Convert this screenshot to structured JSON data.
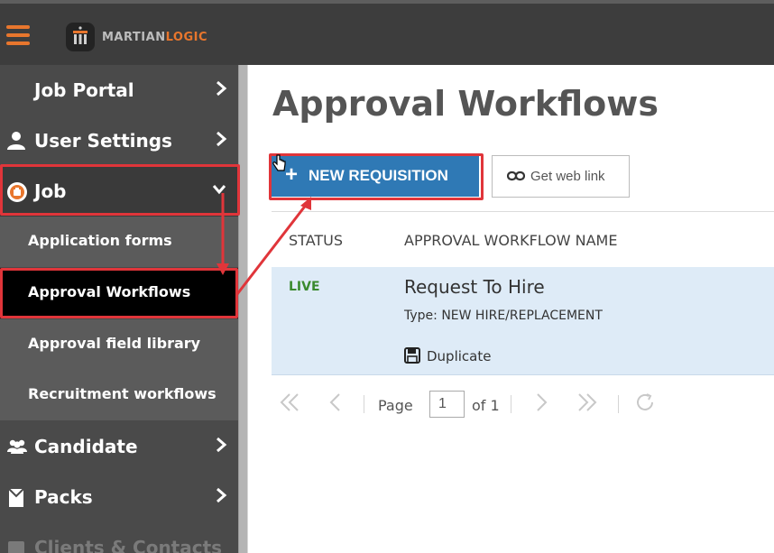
{
  "app": {
    "brand_part1": "MARTIAN",
    "brand_part2": "LOGIC",
    "accent_color": "#e8762d",
    "menu_icon": "hamburger-icon"
  },
  "sidebar": {
    "items": [
      {
        "label": "Job Portal",
        "icon": "",
        "chevron": "chevron-right-icon"
      },
      {
        "label": "User Settings",
        "icon": "user-icon",
        "chevron": "chevron-right-icon"
      },
      {
        "label": "Job",
        "icon": "job-badge-icon",
        "chevron": "chevron-down-icon",
        "expanded": true
      },
      {
        "label": "Application forms",
        "sub": true
      },
      {
        "label": "Approval Workflows",
        "sub": true,
        "active": true
      },
      {
        "label": "Approval field library",
        "sub": true
      },
      {
        "label": "Recruitment workflows",
        "sub": true
      },
      {
        "label": "Candidate",
        "icon": "people-icon",
        "chevron": "chevron-right-icon"
      },
      {
        "label": "Packs",
        "icon": "folder-icon",
        "chevron": "chevron-right-icon"
      },
      {
        "label": "Clients & Contacts",
        "icon": "contacts-icon"
      }
    ]
  },
  "main": {
    "title": "Approval Workflows",
    "new_button_label": "NEW REQUISITION",
    "new_button_color": "#2f79b5",
    "weblink_label": "Get web link",
    "table": {
      "columns": [
        "STATUS",
        "APPROVAL WORKFLOW NAME"
      ],
      "rows": [
        {
          "status": "LIVE",
          "name": "Request To Hire",
          "type": "Type: NEW HIRE/REPLACEMENT",
          "action": "Duplicate"
        }
      ]
    },
    "pager": {
      "page_label": "Page",
      "current_page": "1",
      "of_label": "of 1"
    }
  },
  "annotation_color": "#e0353a"
}
